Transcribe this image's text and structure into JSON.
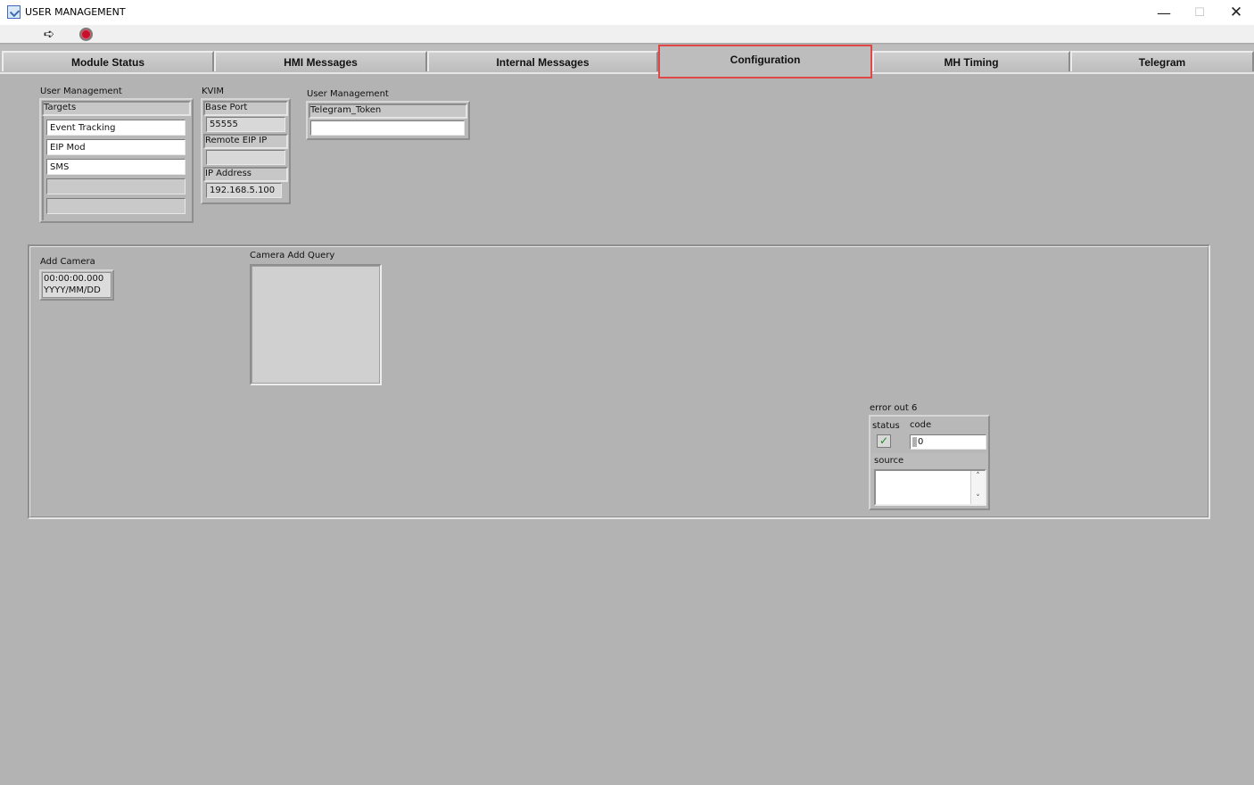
{
  "window": {
    "title": "USER MANAGEMENT",
    "minimize": "—",
    "maximize": "☐",
    "close": "✕"
  },
  "toolbar": {
    "run_icon": "run-arrow-icon",
    "stop_icon": "abort-stop-icon"
  },
  "tabs": [
    {
      "label": "Module Status"
    },
    {
      "label": "HMI Messages"
    },
    {
      "label": "Internal Messages"
    },
    {
      "label": "Configuration",
      "active": true
    },
    {
      "label": "MH Timing"
    },
    {
      "label": "Telegram"
    }
  ],
  "user_management": {
    "label": "User Management",
    "targets_label": "Targets",
    "targets": [
      "Event Tracking",
      "EIP Mod",
      "SMS",
      "",
      ""
    ]
  },
  "kvim": {
    "label": "KVIM",
    "base_port_label": "Base Port",
    "base_port": "55555",
    "remote_eip_label": "Remote EIP IP",
    "remote_eip": "",
    "ip_label": "IP Address",
    "ip": "192.168.5.100"
  },
  "user_management_2": {
    "label": "User Management",
    "token_label": "Telegram_Token",
    "token": ""
  },
  "add_camera": {
    "label": "Add Camera",
    "time": "00:00:00.000",
    "date": "YYYY/MM/DD"
  },
  "camera_add_query": {
    "label": "Camera Add Query"
  },
  "error_out": {
    "label": "error out 6",
    "status_label": "status",
    "code_label": "code",
    "code": "0",
    "source_label": "source",
    "source": "",
    "status_icon": "checkmark-icon"
  },
  "colors": {
    "panel": "#b3b3b3",
    "active_tab_outline": "#e04848",
    "status_ok": "#1c8a1c"
  }
}
